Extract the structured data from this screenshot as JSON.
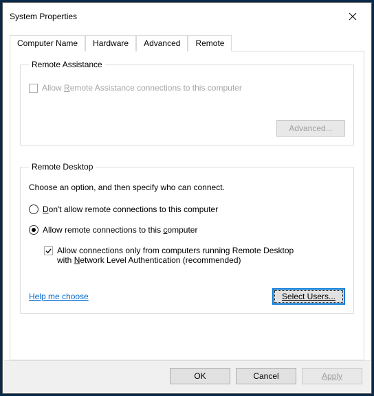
{
  "window": {
    "title": "System Properties"
  },
  "tabs": {
    "items": [
      "Computer Name",
      "Hardware",
      "Advanced",
      "Remote"
    ],
    "active": "Remote"
  },
  "remoteAssistance": {
    "legend": "Remote Assistance",
    "allowLabelPrefix": "Allow ",
    "allowLabelU": "R",
    "allowLabelRest": "emote Assistance connections to this computer",
    "advancedBtn": "Advanced..."
  },
  "remoteDesktop": {
    "legend": "Remote Desktop",
    "prompt": "Choose an option, and then specify who can connect.",
    "opt1U": "D",
    "opt1Rest": "on't allow remote connections to this computer",
    "opt2Prefix": "Allow remote connections to this ",
    "opt2U": "c",
    "opt2Rest": "omputer",
    "nlaLine1": "Allow connections only from computers running Remote Desktop",
    "nlaLine2a": "with ",
    "nlaLine2U": "N",
    "nlaLine2b": "etwork Level Authentication (recommended)",
    "helpLink": "Help me choose",
    "selectUsersBtn": "Select Users..."
  },
  "dialog": {
    "ok": "OK",
    "cancel": "Cancel",
    "apply": "Apply"
  }
}
